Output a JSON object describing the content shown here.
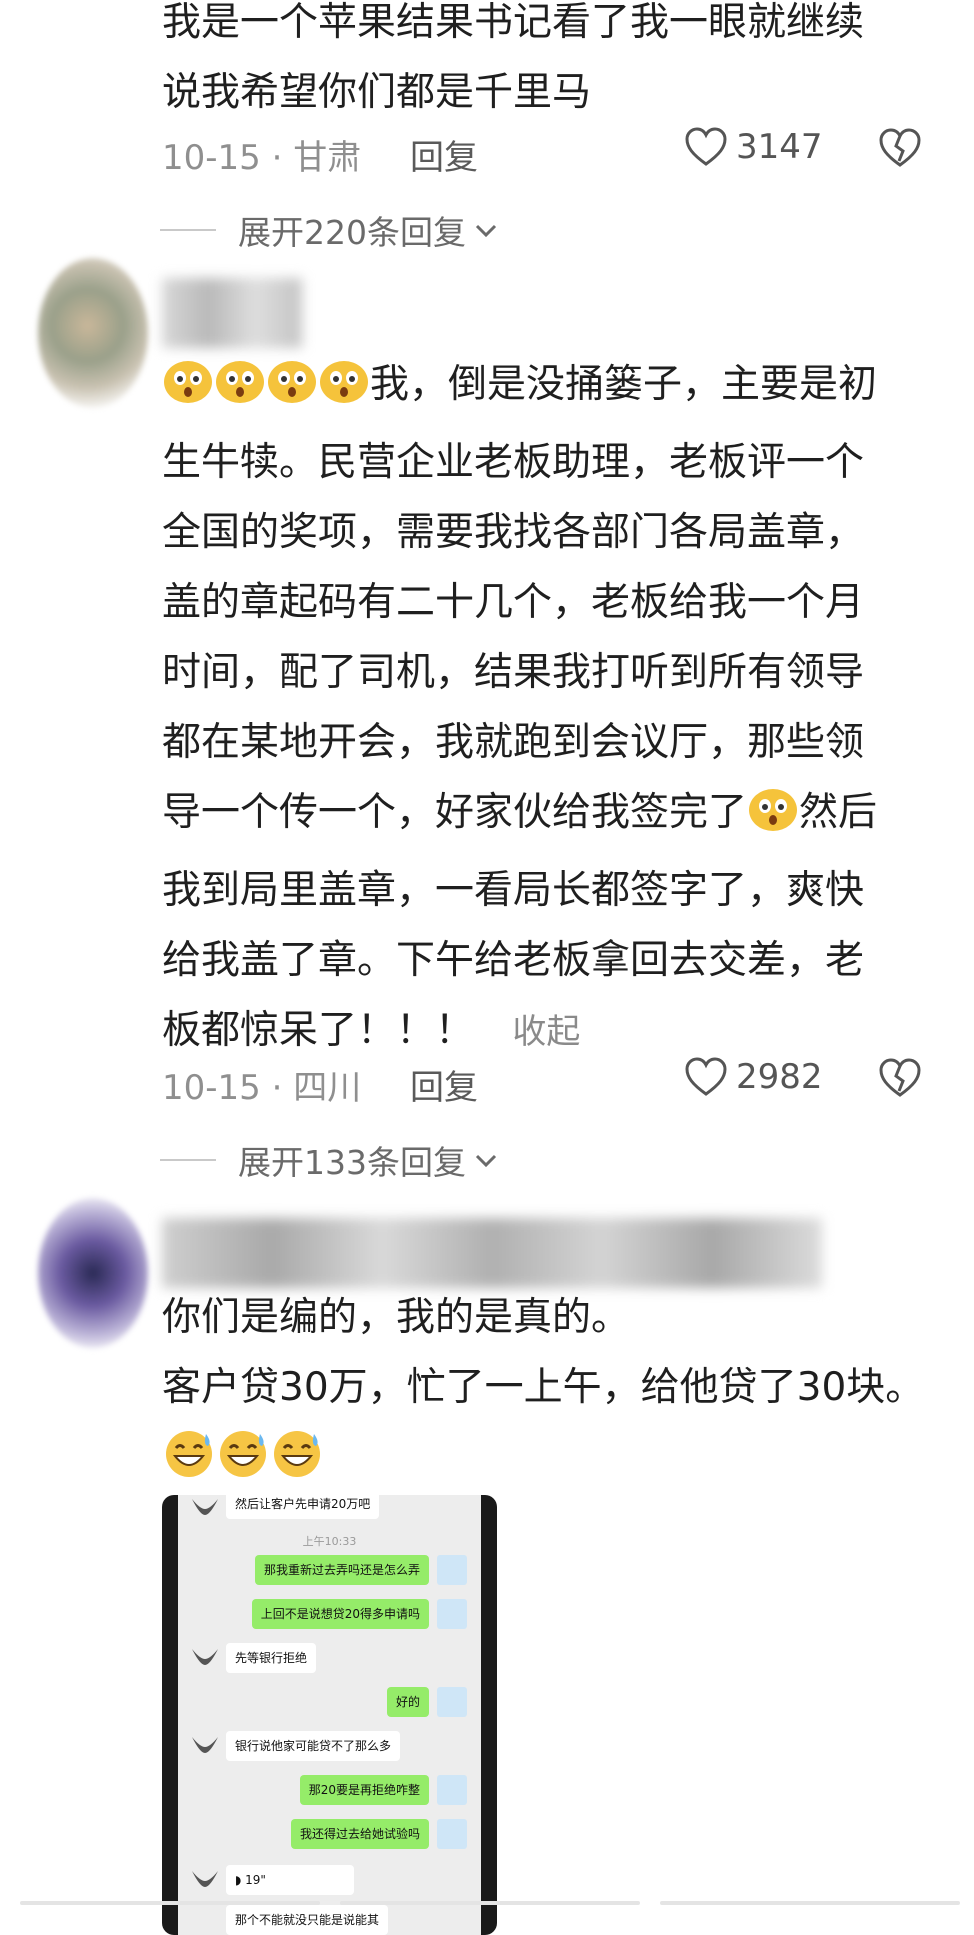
{
  "comment1": {
    "text_lines": [
      "我是一个苹果结果书记看了我一眼就继续",
      "说我希望你们都是千里马"
    ],
    "date": "10-15",
    "location": "甘肃",
    "reply_label": "回复",
    "likes": "3147",
    "expand_label": "展开220条回复"
  },
  "comment2": {
    "text_lines": [
      "我，倒是没捅篓子，主要是初",
      "生牛犊。民营企业老板助理，老板评一个",
      "全国的奖项，需要我找各部门各局盖章，",
      "盖的章起码有二十几个，老板给我一个月",
      "时间，配了司机，结果我打听到所有领导",
      "都在某地开会，我就跑到会议厅，那些领",
      "导一个传一个，好家伙给我签完了",
      "然后",
      "我到局里盖章，一看局长都签字了，爽快",
      "给我盖了章。下午给老板拿回去交差，老",
      "板都惊呆了！！！"
    ],
    "collapse_label": "收起",
    "date": "10-15",
    "location": "四川",
    "reply_label": "回复",
    "likes": "2982",
    "expand_label": "展开133条回复"
  },
  "comment3": {
    "text_lines": [
      "你们是编的，我的是真的。",
      "客户贷30万，忙了一上午，给他贷了30块。"
    ],
    "chat": {
      "top_text": "然后让客户先申请20万吧",
      "time": "上午10:33",
      "messages": [
        {
          "side": "me",
          "text": "那我重新过去弄吗还是怎么弄"
        },
        {
          "side": "me",
          "text": "上回不是说想贷20得多申请吗"
        },
        {
          "side": "them",
          "text": "先等银行拒绝"
        },
        {
          "side": "me",
          "text": "好的"
        },
        {
          "side": "them",
          "text": "银行说他家可能贷不了那么多"
        },
        {
          "side": "me",
          "text": "那20要是再拒绝咋整"
        },
        {
          "side": "me",
          "text": "我还得过去给她试验吗"
        },
        {
          "side": "them",
          "text": "19\""
        }
      ],
      "bottom_text": "那个不能就没只能是说能其"
    }
  },
  "icons": {
    "heart": "heart-outline-icon",
    "dislike": "broken-heart-icon",
    "expand_chevron": "chevron-down-icon",
    "emoji_shocked": "shocked-face-emoji",
    "emoji_sweat": "sweat-smile-emoji"
  },
  "colors": {
    "text": "#1f1f1f",
    "meta": "#8f8f8f",
    "chat_me_bubble": "#95ec69"
  }
}
